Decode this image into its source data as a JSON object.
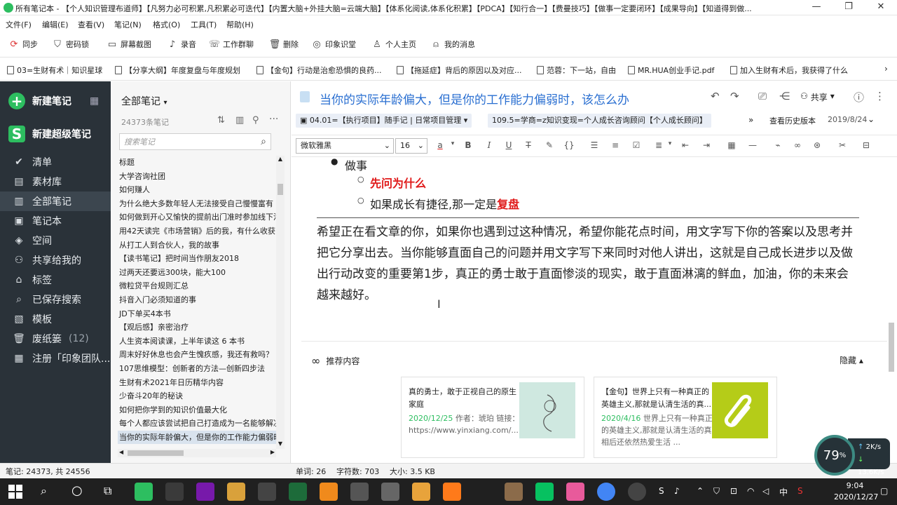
{
  "window": {
    "title": "所有笔记本 - 【个人知识管理布道师】【凡努力必可积累,凡积累必可迭代】【内置大脑+外挂大脑=云端大脑】【体系化阅读,体系化积累】【PDCA】【知行合一】【费曼技巧】【做事一定要闭环】【成果导向】【知道得到做..."
  },
  "menubar": {
    "items": [
      "文件(F)",
      "编辑(E)",
      "查看(V)",
      "笔记(N)",
      "格式(O)",
      "工具(T)",
      "帮助(H)"
    ]
  },
  "toolbar": {
    "items": [
      "同步",
      "密码锁",
      "屏幕截图",
      "录音",
      "工作群聊",
      "删除",
      "印象识堂",
      "个人主页",
      "我的消息"
    ]
  },
  "shortcuts": {
    "items": [
      "03=生财有术｜知识星球",
      "【分享大纲】年度复盘与年度规划",
      "【金句】行动是治愈恐惧的良药...",
      "【拖延症】背后的原因以及对应...",
      "范蓉：下一站，自由",
      "MR.HUA创业手记.pdf",
      "加入生财有术后，我获得了什么"
    ]
  },
  "sidebar": {
    "new_note": "新建笔记",
    "new_super_note": "新建超级笔记",
    "items": [
      {
        "label": "清单",
        "count": ""
      },
      {
        "label": "素材库",
        "count": ""
      },
      {
        "label": "全部笔记",
        "count": ""
      },
      {
        "label": "笔记本",
        "count": ""
      },
      {
        "label": "空间",
        "count": ""
      },
      {
        "label": "共享给我的",
        "count": ""
      },
      {
        "label": "标签",
        "count": ""
      },
      {
        "label": "已保存搜索",
        "count": ""
      },
      {
        "label": "模板",
        "count": ""
      },
      {
        "label": "废纸篓",
        "count": "(12)"
      },
      {
        "label": "注册「印象团队...",
        "count": ""
      }
    ]
  },
  "notelist": {
    "header": "全部笔记",
    "count": "24373条笔记",
    "search_placeholder": "搜索笔记",
    "items": [
      "标题",
      "大学咨询社团",
      "如何赚人",
      "为什么绝大多数年轻人无法接受自己慢慢富有",
      "如何做到开心又愉快的提前出门准时参加线下活动",
      "用42天读完《市场营销》后的我，有什么收获",
      "从打工人到合伙人，我的故事",
      "【读书笔记】把时间当作朋友2018",
      "过两天还要远300块，能大100",
      "微粒贷平台规则汇总",
      "抖音入门必须知道的事",
      "JD下单买4本书",
      "【观后感】亲密治疗",
      "人生资本阅读课，上半年读这 6 本书",
      "周末好好休息也会产生愧疚感，我还有救吗？",
      "107思维模型：创新者的方法—创新四步法",
      "生财有术2021年日历精华内容",
      "少奋斗20年的秘诀",
      "如何把你学到的知识价值最大化",
      "每个人都应该尝试把自己打造成为一名能够解决问题的人",
      "当你的实际年龄偏大，但是你的工作能力偏弱时，该怎么办"
    ],
    "selected_index": 20
  },
  "editor": {
    "title": "当你的实际年龄偏大，但是你的工作能力偏弱时，该怎么办",
    "share": "共享",
    "notebook_tag": "04.01=【执行项目】随手记 | 日常项目管理",
    "tag": "109.5=学商=z知识变现=个人成长咨询顾问【个人成长顾问】",
    "history": "查看历史版本",
    "date": "2019/8/24",
    "font_family": "微软雅黑",
    "font_size": "16",
    "bullet_do": "做事",
    "sub1": "先问为什么",
    "sub2_prefix": "如果成长有捷径,那一定是",
    "sub2_red": "复盘",
    "paragraph": "希望正在看文章的你，如果你也遇到过这种情况，希望你能花点时间，用文字写下你的答案以及思考并把它分享出去。当你能够直面自己的问题并用文字写下来同时对他人讲出，这就是自己成长进步以及做出行动改变的重要第1步，真正的勇士敢于直面惨淡的现实，敢于直面淋漓的鲜血，加油，你的未来会越来越好。"
  },
  "recommend": {
    "header": "推荐内容",
    "hide": "隐藏",
    "cards": [
      {
        "title": "真的勇士，敢于正视自己的原生家庭",
        "date": "2020/12/25",
        "desc": "作者：琥珀 链接：https://www.yinxiang.com/...",
        "thumb_color": "#cfe8e0"
      },
      {
        "title": "【金句】世界上只有一种真正的英雄主义,那就是认清生活的真...",
        "date": "2020/4/16",
        "desc": "世界上只有一种真正的英雄主义,那就是认清生活的真相后还依然热爱生活 ...",
        "thumb_color": "#b5cc18"
      }
    ]
  },
  "statusbar": {
    "notes": "笔记: 24373, 共 24556",
    "words": "单词: 26",
    "chars": "字符数: 703",
    "size": "大小: 3.5 KB"
  },
  "overlay": {
    "percent": "79",
    "up": "2K/s",
    "down": "13.6K/s"
  },
  "taskbar": {
    "time": "9:04",
    "date": "2020/12/27",
    "ime": "中"
  }
}
